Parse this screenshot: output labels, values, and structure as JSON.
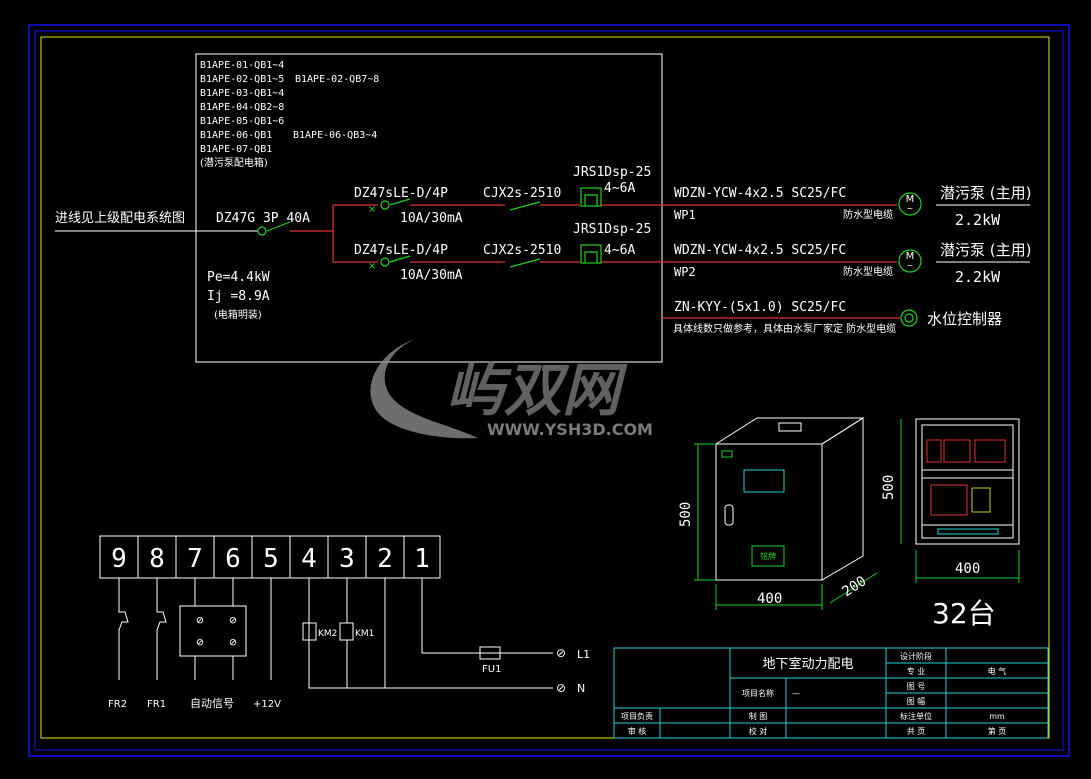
{
  "feeder": {
    "incoming_label": "进线见上级配电系统图",
    "main_breaker": "DZ47G 3P 40A",
    "load_power": "Pe=4.4kW",
    "load_current": "Ij =8.9A",
    "mount_note": "(电箱明装)"
  },
  "panel_list": [
    "B1APE-01-QB1~4",
    "B1APE-02-QB1~5",
    "B1APE-03-QB1~4",
    "B1APE-04-QB2~8",
    "B1APE-05-QB1~6",
    "B1APE-06-QB1",
    "B1APE-07-QB1"
  ],
  "panel_list_extra": [
    "B1APE-02-QB7~8",
    "B1APE-06-QB3~4"
  ],
  "panel_list_note": "(潜污泵配电箱)",
  "circuits": [
    {
      "rcd": "DZ47sLE-D/4P",
      "rcd_rating": "10A/30mA",
      "contactor": "CJX2s-2510",
      "relay": "JRS1Dsp-25",
      "relay_range": "4~6A",
      "cable": "WDZN-YCW-4x2.5 SC25/FC",
      "circuit_id": "WP1",
      "cable_note": "防水型电缆",
      "load_name": "潜污泵 (主用)",
      "load_power": "2.2kW",
      "motor_symbol": "M"
    },
    {
      "rcd": "DZ47sLE-D/4P",
      "rcd_rating": "10A/30mA",
      "contactor": "CJX2s-2510",
      "relay": "JRS1Dsp-25",
      "relay_range": "4~6A",
      "cable": "WDZN-YCW-4x2.5 SC25/FC",
      "circuit_id": "WP2",
      "cable_note": "防水型电缆",
      "load_name": "潜污泵 (主用)",
      "load_power": "2.2kW",
      "motor_symbol": "M"
    }
  ],
  "controller": {
    "cable": "ZN-KYY-(5x1.0) SC25/FC",
    "note": "具体线数只做参考，具体由水泵厂家定  防水型电缆",
    "name": "水位控制器"
  },
  "watermark": {
    "brand": "屿双网",
    "url": "WWW.YSH3D.COM"
  },
  "cabinet": {
    "height_label": "500",
    "width_label": "400",
    "depth_label": "200",
    "nameplate": "铭牌",
    "front_height_label": "500",
    "front_width_label": "400",
    "quantity": "32台"
  },
  "terminals": {
    "numbers": [
      "9",
      "8",
      "7",
      "6",
      "5",
      "4",
      "3",
      "2",
      "1"
    ],
    "labels": {
      "fr2": "FR2",
      "fr1": "FR1",
      "auto_signal": "自动信号",
      "plus12": "+12V",
      "km2": "KM2",
      "km1": "KM1",
      "fu1": "FU1",
      "l1": "L1",
      "n": "N"
    }
  },
  "title_block": {
    "drawing_title": "地下室动力配电",
    "design_stage_label": "设计阶段",
    "specialty_label": "专  业",
    "specialty_value": "电    气",
    "drawing_no_label": "图    号",
    "scale_label": "图    幅",
    "project_name_label": "项目名称",
    "project_name_value": "—",
    "project_lead_label": "项目负责",
    "drafter_label": "制    图",
    "standard_unit_label": "标注单位",
    "standard_unit_value": "mm",
    "reviewer_label": "审    核",
    "checker_label": "校    对",
    "total_pages_label": "共    页",
    "page_label": "第    页"
  }
}
